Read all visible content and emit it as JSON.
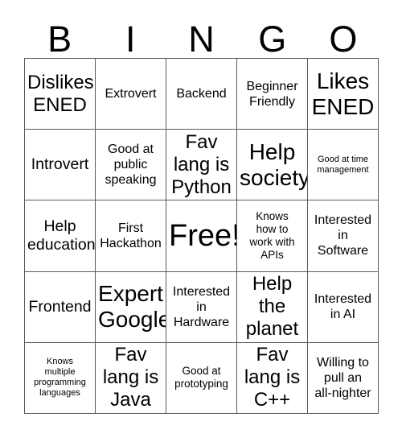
{
  "header": {
    "letters": [
      "B",
      "I",
      "N",
      "G",
      "O"
    ]
  },
  "grid": {
    "rows": 5,
    "columns": 5,
    "border_color": "#5a5a5a",
    "background_color": "#ffffff",
    "text_color": "#000000",
    "cells": [
      {
        "text": "Dislikes\nENED",
        "size": "xl"
      },
      {
        "text": "Extrovert",
        "size": "m"
      },
      {
        "text": "Backend",
        "size": "m"
      },
      {
        "text": "Beginner\nFriendly",
        "size": "m"
      },
      {
        "text": "Likes\nENED",
        "size": "xxl"
      },
      {
        "text": "Introvert",
        "size": "l"
      },
      {
        "text": "Good at\npublic\nspeaking",
        "size": "m"
      },
      {
        "text": "Fav\nlang is\nPython",
        "size": "xl"
      },
      {
        "text": "Help\nsociety",
        "size": "xxl"
      },
      {
        "text": "Good at time\nmanagement",
        "size": "xs"
      },
      {
        "text": "Help\neducation",
        "size": "l"
      },
      {
        "text": "First\nHackathon",
        "size": "m"
      },
      {
        "text": "Free!",
        "size": "free"
      },
      {
        "text": "Knows\nhow to\nwork with\nAPIs",
        "size": "s"
      },
      {
        "text": "Interested\nin\nSoftware",
        "size": "m"
      },
      {
        "text": "Frontend",
        "size": "l"
      },
      {
        "text": "Expert\nGoogler",
        "size": "xxl"
      },
      {
        "text": "Interested\nin\nHardware",
        "size": "m"
      },
      {
        "text": "Help\nthe\nplanet",
        "size": "xl"
      },
      {
        "text": "Interested\nin AI",
        "size": "m"
      },
      {
        "text": "Knows\nmultiple\nprogramming\nlanguages",
        "size": "xs"
      },
      {
        "text": "Fav\nlang is\nJava",
        "size": "xl"
      },
      {
        "text": "Good at\nprototyping",
        "size": "s"
      },
      {
        "text": "Fav\nlang is\nC++",
        "size": "xl"
      },
      {
        "text": "Willing to\npull an\nall-nighter",
        "size": "m"
      }
    ]
  }
}
